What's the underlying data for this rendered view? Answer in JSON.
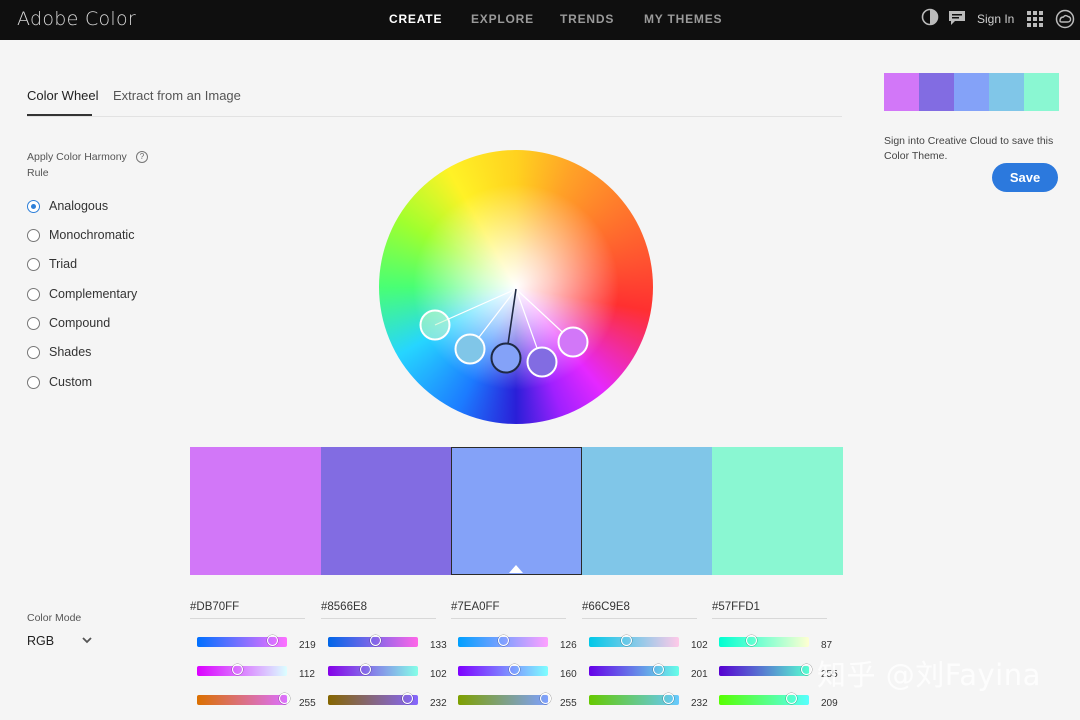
{
  "header": {
    "brand": "Adobe Color",
    "nav": [
      {
        "label": "CREATE",
        "active": true
      },
      {
        "label": "EXPLORE",
        "active": false
      },
      {
        "label": "TRENDS",
        "active": false
      },
      {
        "label": "MY THEMES",
        "active": false
      }
    ],
    "sign_in": "Sign In",
    "icons": [
      "theme-toggle-icon",
      "feedback-icon",
      "apps-grid-icon",
      "creative-cloud-icon"
    ]
  },
  "tabs": [
    {
      "label": "Color Wheel",
      "active": true
    },
    {
      "label": "Extract from an Image",
      "active": false
    }
  ],
  "harmony": {
    "label": "Apply Color Harmony Rule",
    "rules": [
      {
        "label": "Analogous",
        "selected": true
      },
      {
        "label": "Monochromatic",
        "selected": false
      },
      {
        "label": "Triad",
        "selected": false
      },
      {
        "label": "Complementary",
        "selected": false
      },
      {
        "label": "Compound",
        "selected": false
      },
      {
        "label": "Shades",
        "selected": false
      },
      {
        "label": "Custom",
        "selected": false
      }
    ]
  },
  "swatches": [
    {
      "hex": "#DB70FF",
      "color": "#D277F8",
      "rgb": [
        219,
        112,
        255
      ],
      "selected": false
    },
    {
      "hex": "#8566E8",
      "color": "#826CE2",
      "rgb": [
        133,
        102,
        232
      ],
      "selected": false
    },
    {
      "hex": "#7EA0FF",
      "color": "#84A2F8",
      "rgb": [
        126,
        160,
        255
      ],
      "selected": true
    },
    {
      "hex": "#66C9E8",
      "color": "#80C6E8",
      "rgb": [
        102,
        201,
        232
      ],
      "selected": false
    },
    {
      "hex": "#57FFD1",
      "color": "#8AF7D2",
      "rgb": [
        87,
        255,
        209
      ],
      "selected": false
    }
  ],
  "color_mode": {
    "label": "Color Mode",
    "value": "RGB"
  },
  "save_panel": {
    "message": "Sign into Creative Cloud to save this Color Theme.",
    "save_label": "Save"
  },
  "watermark": "知乎 @刘Fayina"
}
